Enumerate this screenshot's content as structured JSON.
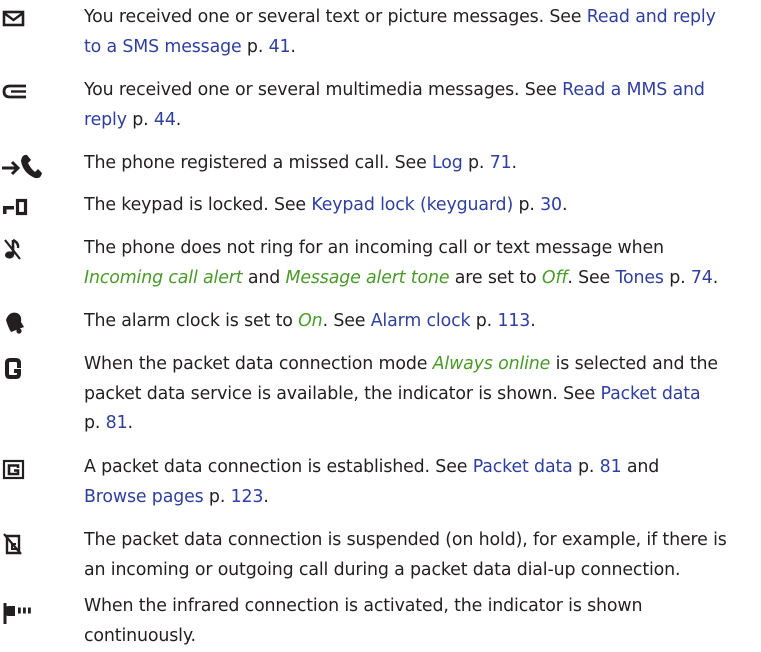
{
  "colors": {
    "text": "#231f20",
    "link": "#2e3f9f",
    "emphasis": "#4a9a2a"
  },
  "entries": [
    {
      "icon": "envelope-icon",
      "lines": [
        [
          {
            "t": "You received one or several text or picture messages. See "
          },
          {
            "t": "Read and reply",
            "k": "link"
          }
        ],
        [
          {
            "t": "to a SMS message",
            "k": "link"
          },
          {
            "t": " p. "
          },
          {
            "t": "41",
            "k": "link"
          },
          {
            "t": "."
          }
        ]
      ]
    },
    {
      "icon": "multimedia-message-icon",
      "lines": [
        [
          {
            "t": "You received one or several multimedia messages. See "
          },
          {
            "t": "Read a MMS and",
            "k": "link"
          }
        ],
        [
          {
            "t": "reply",
            "k": "link"
          },
          {
            "t": " p. "
          },
          {
            "t": "44",
            "k": "link"
          },
          {
            "t": "."
          }
        ]
      ]
    },
    {
      "icon": "missed-call-icon",
      "lines": [
        [
          {
            "t": "The phone registered a missed call. See "
          },
          {
            "t": "Log",
            "k": "link"
          },
          {
            "t": " p. "
          },
          {
            "t": "71",
            "k": "link"
          },
          {
            "t": "."
          }
        ]
      ]
    },
    {
      "icon": "keypad-lock-icon",
      "lines": [
        [
          {
            "t": "The keypad is locked. See "
          },
          {
            "t": "Keypad lock (keyguard)",
            "k": "link"
          },
          {
            "t": " p. "
          },
          {
            "t": "30",
            "k": "link"
          },
          {
            "t": "."
          }
        ]
      ]
    },
    {
      "icon": "silent-note-icon",
      "lines": [
        [
          {
            "t": "The phone does not ring for an incoming call or text message when"
          }
        ],
        [
          {
            "t": "Incoming call alert",
            "k": "em"
          },
          {
            "t": " and "
          },
          {
            "t": "Message alert tone",
            "k": "em"
          },
          {
            "t": " are set to "
          },
          {
            "t": "Off",
            "k": "em"
          },
          {
            "t": ". See "
          },
          {
            "t": "Tones",
            "k": "link"
          },
          {
            "t": " p. "
          },
          {
            "t": "74",
            "k": "link"
          },
          {
            "t": "."
          }
        ]
      ]
    },
    {
      "icon": "alarm-bell-icon",
      "lines": [
        [
          {
            "t": "The alarm clock is set to "
          },
          {
            "t": "On",
            "k": "em"
          },
          {
            "t": ". See "
          },
          {
            "t": "Alarm clock",
            "k": "link"
          },
          {
            "t": " p. "
          },
          {
            "t": "113",
            "k": "link"
          },
          {
            "t": "."
          }
        ]
      ]
    },
    {
      "icon": "gprs-always-online-icon",
      "lines": [
        [
          {
            "t": "When the packet data connection mode "
          },
          {
            "t": "Always online",
            "k": "em"
          },
          {
            "t": " is selected and the"
          }
        ],
        [
          {
            "t": "packet data service is available, the indicator is shown. See "
          },
          {
            "t": "Packet data",
            "k": "link"
          }
        ],
        [
          {
            "t": "p. "
          },
          {
            "t": "81",
            "k": "link"
          },
          {
            "t": "."
          }
        ]
      ]
    },
    {
      "icon": "gprs-connected-icon",
      "lines": [
        [
          {
            "t": "A packet data connection is established. See "
          },
          {
            "t": "Packet data",
            "k": "link"
          },
          {
            "t": " p. "
          },
          {
            "t": "81",
            "k": "link"
          },
          {
            "t": " and"
          }
        ],
        [
          {
            "t": "Browse pages",
            "k": "link"
          },
          {
            "t": " p. "
          },
          {
            "t": "123",
            "k": "link"
          },
          {
            "t": "."
          }
        ]
      ]
    },
    {
      "icon": "gprs-suspended-icon",
      "lines": [
        [
          {
            "t": "The packet data connection is suspended (on hold), for example, if there is"
          }
        ],
        [
          {
            "t": "an incoming or outgoing call during a packet data dial-up connection."
          }
        ]
      ]
    },
    {
      "icon": "infrared-icon",
      "lines": [
        [
          {
            "t": "When the infrared connection is activated, the indicator is shown"
          }
        ],
        [
          {
            "t": "continuously."
          }
        ]
      ]
    }
  ]
}
